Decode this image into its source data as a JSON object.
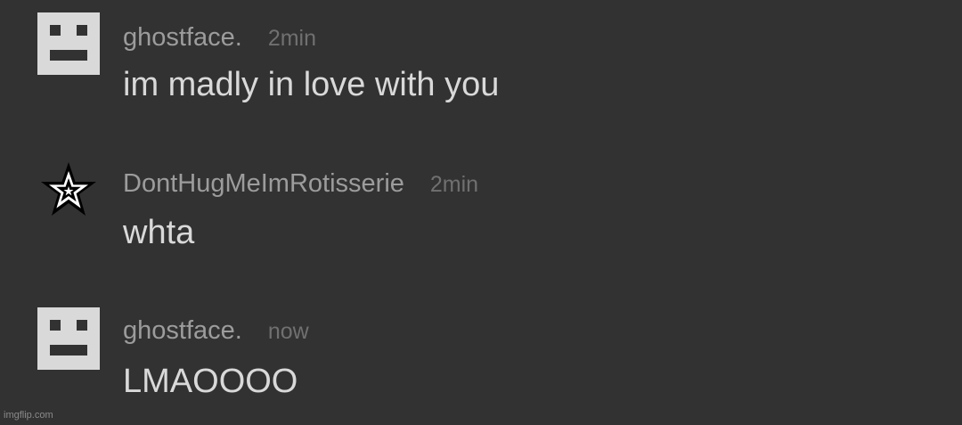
{
  "messages": [
    {
      "username": "ghostface.",
      "time": "2min",
      "text": "im madly in love with you",
      "avatar_icon": "block-face-icon"
    },
    {
      "username": "DontHugMeImRotisserie",
      "time": "2min",
      "text": "whta",
      "avatar_icon": "star-icon"
    },
    {
      "username": "ghostface.",
      "time": "now",
      "text": "LMAOOOO",
      "avatar_icon": "block-face-icon"
    }
  ],
  "watermark": "imgflip.com",
  "colors": {
    "background": "#323232",
    "username": "#9c9c9c",
    "timestamp": "#707070",
    "message_text": "#d9d9d9",
    "avatar_block": "#d9d9d9"
  }
}
